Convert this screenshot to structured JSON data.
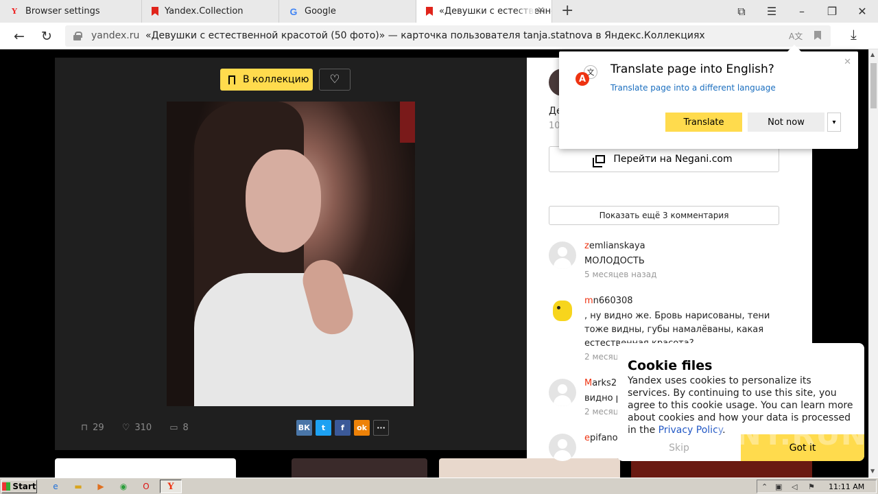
{
  "tabs": [
    {
      "title": "Browser settings",
      "icon": "yandex-icon"
    },
    {
      "title": "Yandex.Collection",
      "icon": "bookmark-icon"
    },
    {
      "title": "Google",
      "icon": "google-icon"
    },
    {
      "title": "«Девушки с естественной красотой (50 фото)»",
      "icon": "bookmark-icon"
    }
  ],
  "address": {
    "host": "yandex.ru",
    "title": "«Девушки с естественной красотой (50 фото)» — карточка пользователя tanja.statnova в Яндекс.Коллекциях"
  },
  "card": {
    "collection_button": "В коллекцию",
    "stats": {
      "saves": "29",
      "likes": "310",
      "comments": "8"
    },
    "share": [
      "ВК",
      "t",
      "f",
      "ok",
      "···"
    ]
  },
  "side": {
    "partial_text": "Де",
    "partial_count": "10",
    "goto_button": "Перейти на Negani.com",
    "more_comments": "Показать ещё 3 комментария",
    "comments": [
      {
        "user_first": "z",
        "user_rest": "emlianskaya",
        "text": "МОЛОДОСТЬ",
        "time": "5 месяцев назад"
      },
      {
        "user_first": "m",
        "user_rest": "n660308",
        "text": ", ну видно же. Бровь нарисованы, тени тоже видны, губы намалёваны, какая естественная красота?",
        "time": "2 месяц"
      },
      {
        "user_first": "M",
        "user_rest": "arks2",
        "text": "видно р",
        "time": "2 месяц"
      },
      {
        "user_first": "e",
        "user_rest": "pifano",
        "text": "",
        "time": ""
      }
    ]
  },
  "translate_popup": {
    "title": "Translate page into English?",
    "link": "Translate page into a different language",
    "translate_button": "Translate",
    "not_now_button": "Not now"
  },
  "cookie_popup": {
    "title": "Cookie files",
    "text": "Yandex uses cookies to personalize its services. By continuing to use this site, you agree to this cookie usage. You can learn more about cookies and how your data is processed in the ",
    "link": "Privacy Policy",
    "skip": "Skip",
    "got_it": "Got it"
  },
  "watermark": "ANY.RUN",
  "taskbar": {
    "start": "Start",
    "time": "11:11 AM"
  },
  "colors": {
    "accent_yellow": "#ffdb4d",
    "vk": "#4a76a8",
    "twitter": "#1da1f2",
    "facebook": "#3b5998",
    "ok": "#ee8208"
  }
}
